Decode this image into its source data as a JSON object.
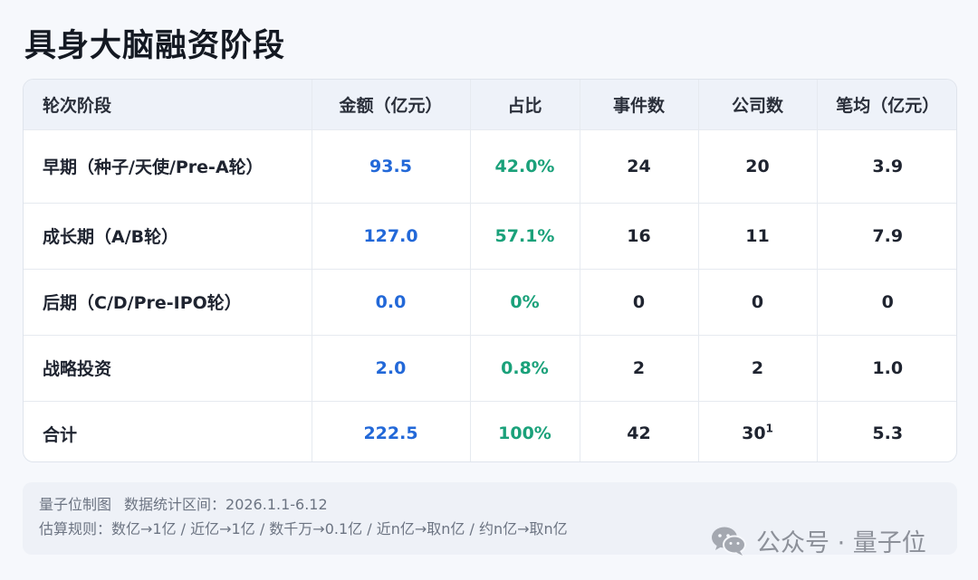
{
  "title": "具身大脑融资阶段",
  "table": {
    "headers": [
      "轮次阶段",
      "金额（亿元）",
      "占比",
      "事件数",
      "公司数",
      "笔均（亿元）"
    ],
    "rows": [
      {
        "stage": "早期（种子/天使/Pre-A轮）",
        "amount": "93.5",
        "share": "42.0%",
        "events": "24",
        "companies": "20",
        "companies_note": "",
        "avg": "3.9"
      },
      {
        "stage": "成长期（A/B轮）",
        "amount": "127.0",
        "share": "57.1%",
        "events": "16",
        "companies": "11",
        "companies_note": "",
        "avg": "7.9"
      },
      {
        "stage": "后期（C/D/Pre-IPO轮）",
        "amount": "0.0",
        "share": "0%",
        "events": "0",
        "companies": "0",
        "companies_note": "",
        "avg": "0"
      },
      {
        "stage": "战略投资",
        "amount": "2.0",
        "share": "0.8%",
        "events": "2",
        "companies": "2",
        "companies_note": "",
        "avg": "1.0"
      },
      {
        "stage": "合计",
        "amount": "222.5",
        "share": "100%",
        "events": "42",
        "companies": "30",
        "companies_note": "1",
        "avg": "5.3"
      }
    ]
  },
  "footer": {
    "source": "量子位制图",
    "period": "数据统计区间：2026.1.1-6.12",
    "rules": "估算规则：数亿→1亿 / 近亿→1亿 / 数千万→0.1亿 / 近n亿→取n亿 / 约n亿→取n亿"
  },
  "watermark": {
    "text": "公众号 · 量子位",
    "icon": "wechat-icon"
  },
  "colors": {
    "amount": "#2268d8",
    "share": "#1aa17a",
    "header_bg": "#eef2f9"
  }
}
